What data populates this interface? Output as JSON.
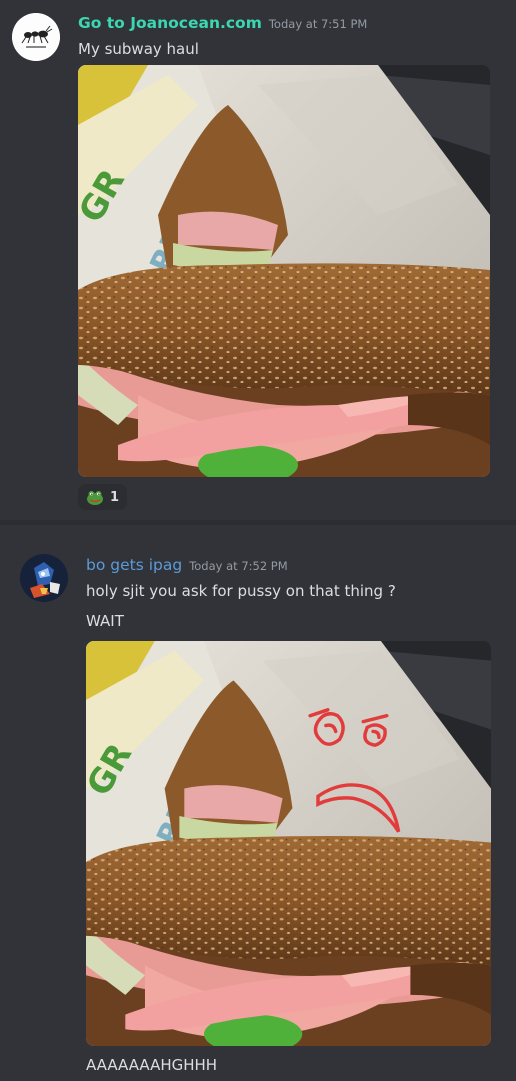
{
  "colors": {
    "background": "#313338",
    "user1_name": "#3ad7b1",
    "user2_name": "#5b9bd9",
    "timestamp": "#949ba4",
    "text": "#dbdee1"
  },
  "messages": [
    {
      "username": "Go to Joanocean.com",
      "timestamp": "Today at 7:51 PM",
      "avatar_icon": "ant-avatar-icon",
      "lines": [
        "My subway haul"
      ],
      "image_subject": "subway-sandwich-photo",
      "reactions": [
        {
          "icon": "frog-emoji-icon",
          "count": "1"
        }
      ]
    },
    {
      "username": "bo gets ipag",
      "timestamp": "Today at 7:52 PM",
      "avatar_icon": "robot-avatar-icon",
      "lines": [
        "holy sjit you ask for pussy on that thing ?",
        "WAIT"
      ],
      "image_subject": "subway-sandwich-photo-with-face-drawing",
      "after_image_line": "AAAAAAAHGHHH"
    }
  ]
}
